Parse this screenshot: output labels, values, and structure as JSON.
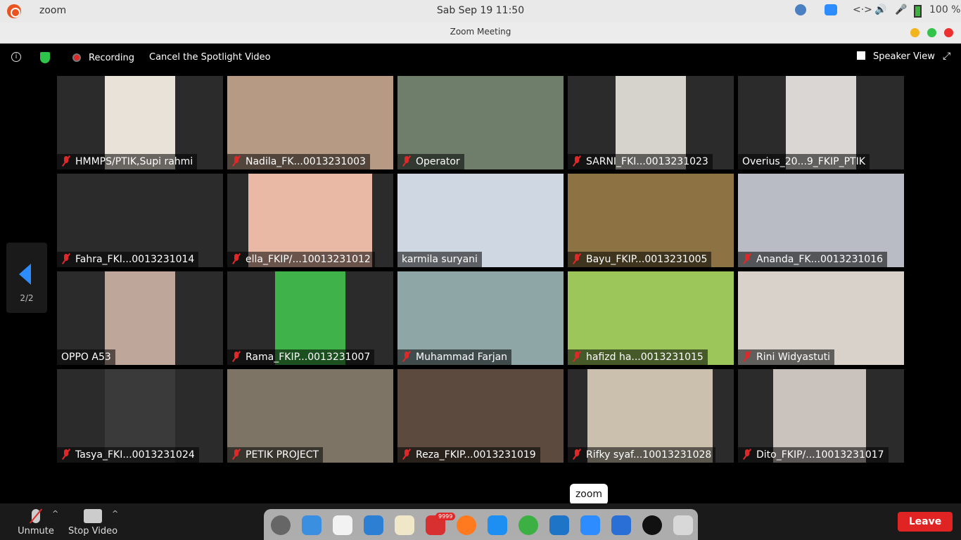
{
  "system_bar": {
    "app_name": "zoom",
    "clock": "Sab Sep 19  11:50",
    "network_label": "<·>",
    "battery": "100 %"
  },
  "window": {
    "title": "Zoom Meeting"
  },
  "meeting_top": {
    "info_glyph": "i",
    "recording": "Recording",
    "cancel_spotlight": "Cancel the Spotlight Video",
    "speaker_view": "Speaker View"
  },
  "pagination": {
    "page": "2/2"
  },
  "participants": [
    {
      "name": "HMMPS/PTIK,Supi rahmi",
      "muted": true,
      "color": "#e8e2d8"
    },
    {
      "name": "Nadila_FK...0013231003",
      "muted": true,
      "color": "#b79a84"
    },
    {
      "name": "Operator",
      "muted": true,
      "color": "#6e7e6a"
    },
    {
      "name": "SARNI_FKI...0013231023",
      "muted": true,
      "color": "#d6d2cc"
    },
    {
      "name": "Overius_20...9_FKIP_PTIK",
      "muted": false,
      "color": "#d9d6d3"
    },
    {
      "name": "Fahra_FKI...0013231014",
      "muted": true,
      "color": "#2b2b2b"
    },
    {
      "name": "ella_FKIP/...10013231012",
      "muted": true,
      "color": "#e9b9a6"
    },
    {
      "name": "karmila suryani",
      "muted": false,
      "color": "#cfd8e2"
    },
    {
      "name": "Bayu_FKIP...0013231005",
      "muted": true,
      "color": "#8d7344"
    },
    {
      "name": "Ananda_FK...0013231016",
      "muted": true,
      "color": "#b9bcc4"
    },
    {
      "name": "OPPO A53",
      "muted": false,
      "color": "#bfa69a"
    },
    {
      "name": "Rama_FKIP...0013231007",
      "muted": true,
      "color": "#3fb24a"
    },
    {
      "name": "Muhammad Farjan",
      "muted": true,
      "color": "#8fa6a6"
    },
    {
      "name": "hafizd ha...0013231015",
      "muted": true,
      "color": "#9cc55a"
    },
    {
      "name": "Rini Widyastuti",
      "muted": true,
      "color": "#d8d2ca"
    },
    {
      "name": "Tasya_FKI...0013231024",
      "muted": true,
      "color": "#3a3a3a"
    },
    {
      "name": "PETIK PROJECT",
      "muted": true,
      "color": "#7d7466"
    },
    {
      "name": "Reza_FKIP...0013231019",
      "muted": true,
      "color": "#5c4a3e"
    },
    {
      "name": "Rifky syaf...10013231028",
      "muted": true,
      "color": "#cbbfae"
    },
    {
      "name": "Dito_FKIP/...10013231017",
      "muted": true,
      "color": "#c9c2bd"
    }
  ],
  "toolbar": {
    "unmute": "Unmute",
    "stop_video": "Stop Video",
    "leave": "Leave"
  },
  "dock": {
    "tooltip": "zoom",
    "badge": "9999"
  }
}
